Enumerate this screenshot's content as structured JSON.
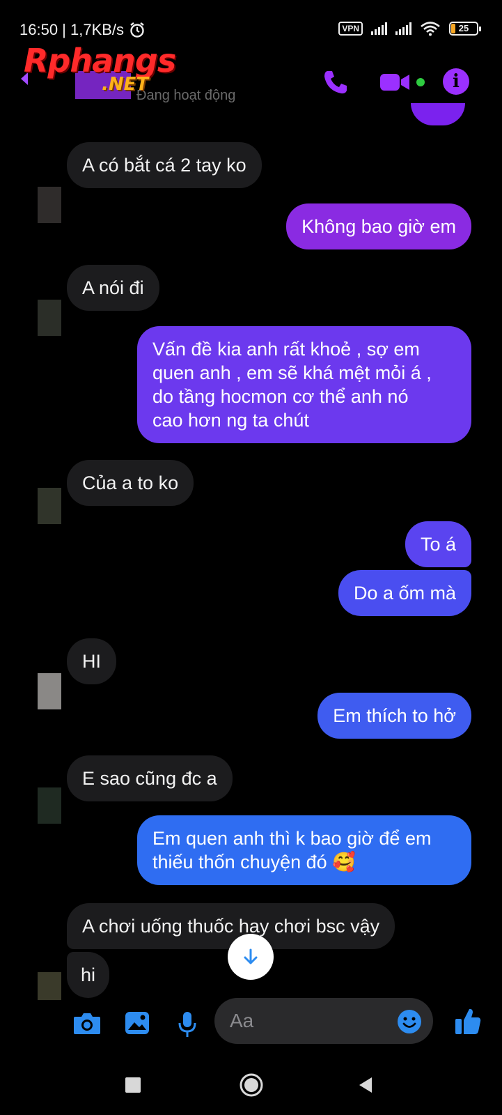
{
  "status_bar": {
    "time_speed": "16:50 | 1,7KB/s",
    "vpn": "VPN",
    "battery": "25"
  },
  "watermark": {
    "line1": "Rphangs",
    "line2": ".NET"
  },
  "header": {
    "active_status": "Đang hoạt động"
  },
  "messages": [
    {
      "side": "in",
      "text": "A có bắt cá 2 tay ko"
    },
    {
      "side": "out",
      "text": "Không bao giờ em"
    },
    {
      "side": "in",
      "text": "A nói đi"
    },
    {
      "side": "out",
      "text": "Vấn đề kia anh rất khoẻ , sợ em\nquen anh , em sẽ khá mệt mỏi á ,\ndo tầng hocmon cơ thể anh nó\ncao hơn ng ta chút"
    },
    {
      "side": "in",
      "text": "Của a to ko"
    },
    {
      "side": "out",
      "text": "To á"
    },
    {
      "side": "out",
      "text": "Do a ốm mà"
    },
    {
      "side": "in",
      "text": "HI"
    },
    {
      "side": "out",
      "text": "Em thích to hở"
    },
    {
      "side": "in",
      "text": "E sao cũng đc a"
    },
    {
      "side": "out",
      "text": "Em quen anh thì k bao giờ để em\nthiếu thốn chuyện đó 🥰"
    },
    {
      "side": "in",
      "text": "A chơi uống thuốc hay chơi bsc vậy"
    },
    {
      "side": "in",
      "text": "hi"
    }
  ],
  "composer": {
    "placeholder": "Aa",
    "icons": [
      "camera-icon",
      "gallery-icon",
      "microphone-icon",
      "emoji-icon",
      "like-icon"
    ]
  },
  "colors": {
    "bubble_in": "#1c1c1e",
    "bubble_out_purple": "#8a2be2",
    "bubble_out_violet": "#6c39ee",
    "bubble_out_blue": "#3f5cf0",
    "bubble_out_bright_blue": "#2f6df2",
    "accent_purple": "#9b30ff",
    "accent_blue": "#2d8cf0"
  }
}
